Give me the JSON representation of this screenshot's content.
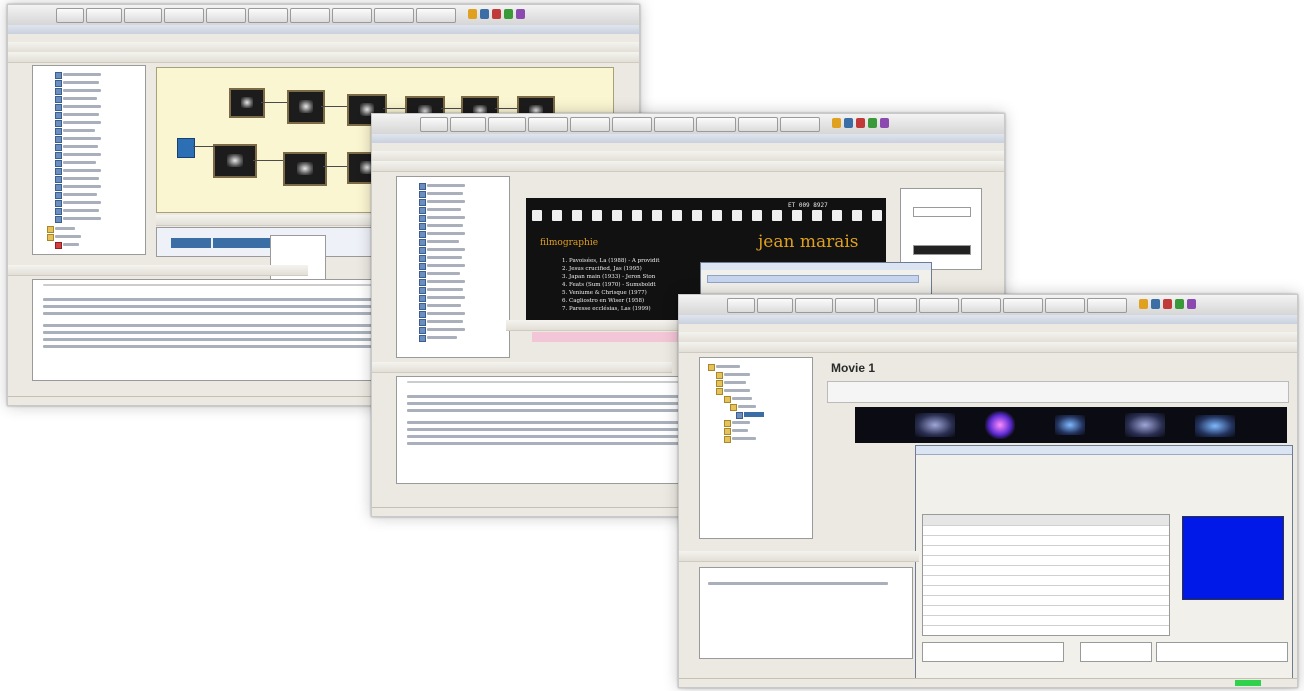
{
  "screenshots": [
    {
      "id": "shot-1",
      "view": "storyboard-graph"
    },
    {
      "id": "shot-2",
      "view": "film-strip-preview"
    },
    {
      "id": "shot-3",
      "view": "subtitle-editor"
    }
  ],
  "film_preview": {
    "title_left": "filmographie",
    "title_right": "jean marais",
    "corner_text": "ET 009 8927",
    "film_list": [
      "1. Pavoisées, La (1988) - A providit",
      "2. Jesus crucified, Jas (1995)",
      "3. Japan main (1933) - Jeron Ston",
      "4. Feats (Sum (1970) - Sumsboldt",
      "5. Veniume & Chrisque (1977)",
      "6. Cagliostro en Wiser (1958)",
      "7. Paresse ecclésias, Las (1999)"
    ]
  },
  "movie_panel": {
    "title": "Movie 1"
  },
  "colors": {
    "desktop_bg": "#ffffff",
    "window_chrome": "#ece9e2",
    "graph_bg": "#fbf6d2",
    "subtitle_preview": "#0018e8",
    "status_green": "#2fd24a",
    "selection_blue": "#3a6ea5",
    "title_orange": "#e0a020"
  },
  "icons": [
    "folder-icon",
    "film-icon",
    "music-icon",
    "play-icon",
    "stop-icon",
    "save-icon",
    "open-icon",
    "cut-icon"
  ]
}
